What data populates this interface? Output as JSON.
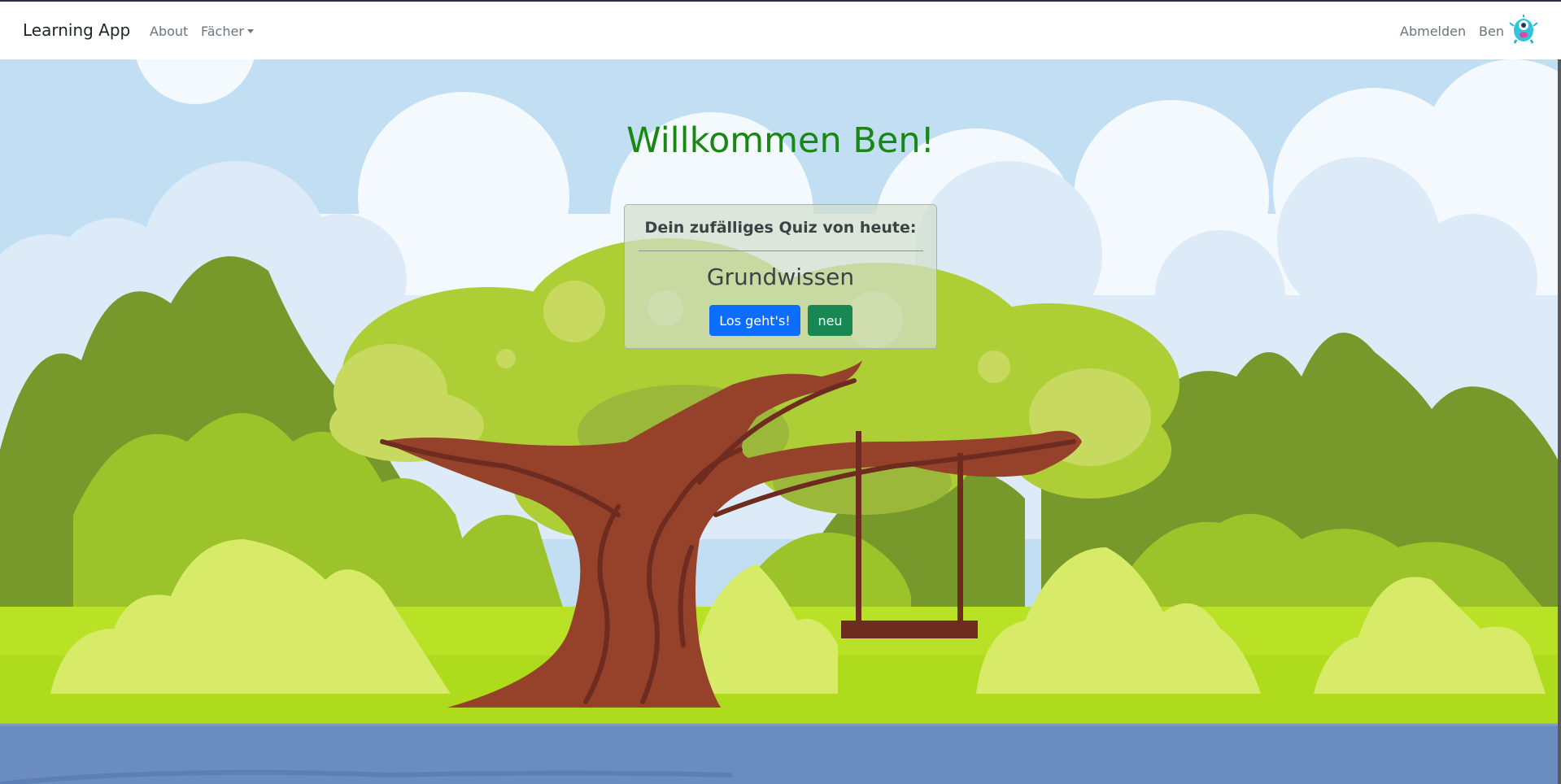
{
  "navbar": {
    "brand": "Learning App",
    "links": {
      "about": "About",
      "subjects": "Fächer"
    },
    "logout": "Abmelden",
    "username": "Ben",
    "avatar_icon": "monster-avatar-icon"
  },
  "main": {
    "welcome": "Willkommen Ben!",
    "quiz_card": {
      "heading": "Dein zufälliges Quiz von heute:",
      "topic": "Grundwissen",
      "start_button": "Los geht's!",
      "new_button": "neu"
    }
  },
  "colors": {
    "welcome_text": "#198711",
    "primary_button": "#0d6efd",
    "success_button": "#198754",
    "sky": "#c2def2",
    "grass": "#aedb1c"
  }
}
